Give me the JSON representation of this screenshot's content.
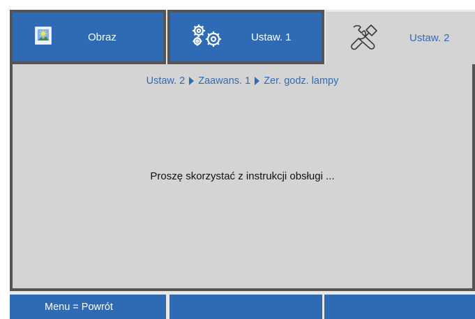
{
  "tabs": [
    {
      "label": "Obraz",
      "icon": "picture-settings-icon",
      "active": false
    },
    {
      "label": "Ustaw. 1",
      "icon": "gears-icon",
      "active": false
    },
    {
      "label": "Ustaw. 2",
      "icon": "tools-icon",
      "active": true
    }
  ],
  "breadcrumb": [
    "Ustaw. 2",
    "Zaawans. 1",
    "Zer. godz. lampy"
  ],
  "message": "Proszę skorzystać z instrukcji obsługi ...",
  "bottom_bar": [
    "Menu = Powrót",
    "",
    ""
  ],
  "colors": {
    "accent": "#2f6bb5",
    "panel": "#d4d4d4",
    "frame": "#555555",
    "background": "#e8e8e8"
  }
}
